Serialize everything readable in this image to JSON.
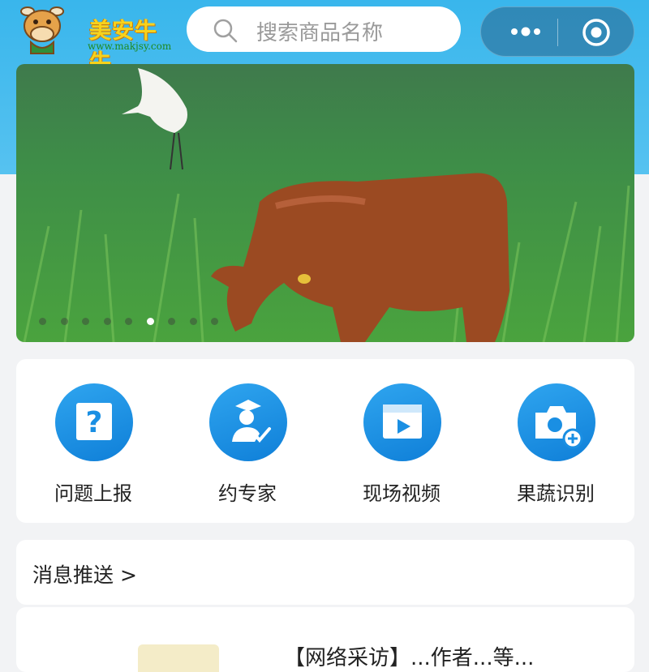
{
  "header": {
    "logo_text": "美安牛牛",
    "logo_url": "www.makjsy.com",
    "search_placeholder": "搜索商品名称",
    "more_icon": "more-dots-icon",
    "close_icon": "target-circle-icon"
  },
  "banner": {
    "slide_count": 9,
    "active_index": 5
  },
  "menu": [
    {
      "label": "问题上报",
      "icon": "question-report-icon"
    },
    {
      "label": "约专家",
      "icon": "expert-icon"
    },
    {
      "label": "现场视频",
      "icon": "video-icon"
    },
    {
      "label": "果蔬识别",
      "icon": "camera-add-icon"
    }
  ],
  "messages": {
    "title": "消息推送 >"
  },
  "news": {
    "first_item_text": "【网络采访】...作者...等..."
  },
  "colors": {
    "accent": "#39b6ec",
    "icon_blue": "#1a8fe3",
    "logo_yellow": "#f7d21c"
  }
}
